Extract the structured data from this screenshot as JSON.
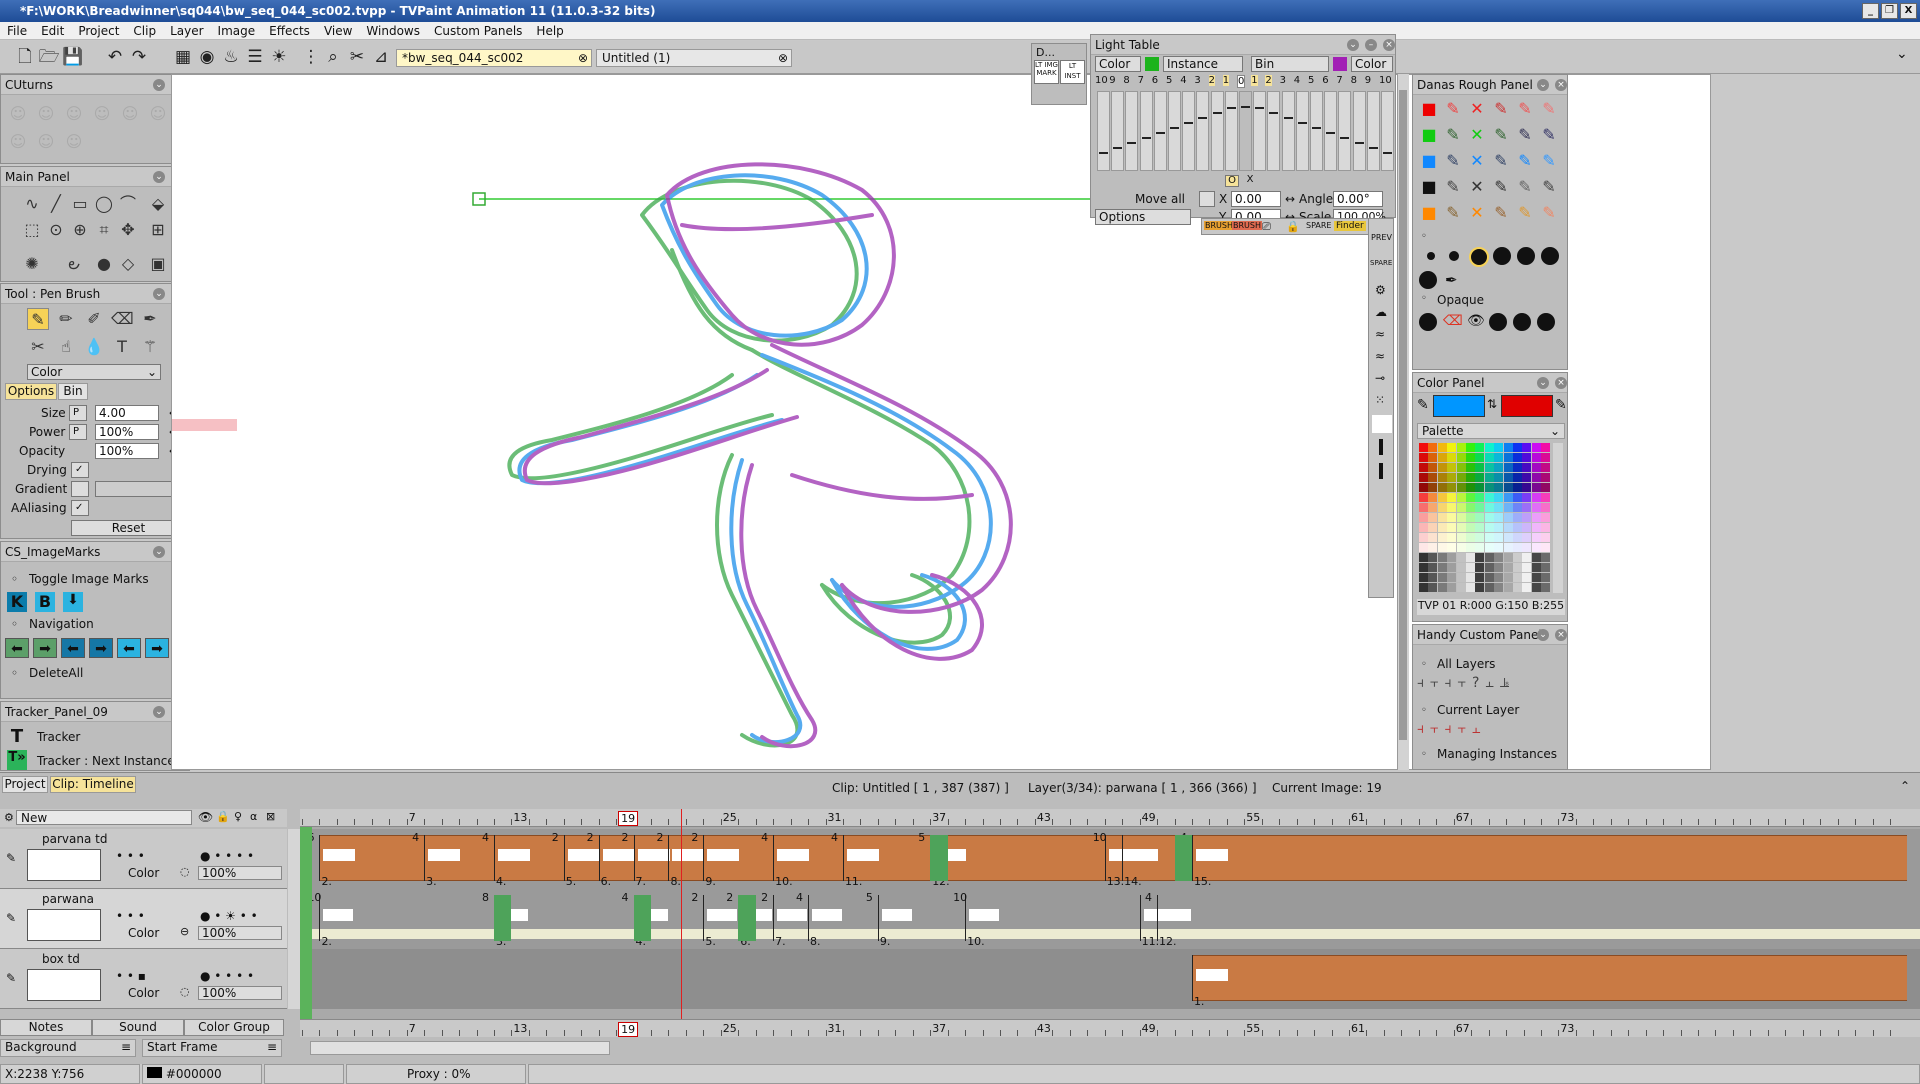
{
  "window": {
    "title": "*F:\\WORK\\Breadwinner\\sq044\\bw_seq_044_sc002.tvpp - TVPaint Animation 11 (11.0.3-32 bits)",
    "min": "_",
    "max": "❐",
    "close": "X"
  },
  "menu": [
    "File",
    "Edit",
    "Project",
    "Clip",
    "Layer",
    "Image",
    "Effects",
    "View",
    "Windows",
    "Custom Panels",
    "Help"
  ],
  "doc_tabs": {
    "active": "*bw_seq_044_sc002",
    "inactive": "Untitled (1)"
  },
  "cuturns": {
    "title": "CUturns"
  },
  "main_panel": {
    "title": "Main Panel"
  },
  "tool_panel": {
    "title": "Tool : Pen Brush",
    "mode": "Color",
    "tab_options": "Options",
    "tab_bin": "Bin",
    "size_label": "Size",
    "size": "4.00",
    "power_label": "Power",
    "power": "100%",
    "opacity_label": "Opacity",
    "opacity": "100%",
    "drying_label": "Drying",
    "gradient_label": "Gradient",
    "aaliasing_label": "AAliasing",
    "reset": "Reset",
    "p": "P"
  },
  "imagemarks": {
    "title": "CS_ImageMarks",
    "toggle": "Toggle Image Marks",
    "k": "K",
    "b": "B",
    "navigation": "Navigation",
    "deleteall": "DeleteAll"
  },
  "tracker": {
    "title": "Tracker_Panel_09",
    "tracker": "Tracker",
    "next": "Tracker : Next Instance"
  },
  "d_panel": {
    "title": "D...",
    "lt_mark": "LT IMG MARK",
    "lt_inst": "LT INST"
  },
  "light_table": {
    "title": "Light Table",
    "color1": "Color",
    "instance": "Instance",
    "bin": "Bin",
    "color2": "Color",
    "left_nums": [
      "10",
      "9",
      "8",
      "7",
      "6",
      "5",
      "4",
      "3",
      "2",
      "1"
    ],
    "center": "0",
    "right_nums": [
      "1",
      "2",
      "3",
      "4",
      "5",
      "6",
      "7",
      "8",
      "9",
      "10"
    ],
    "o": "O",
    "x": "X",
    "move_all": "Move all",
    "x_label": "X",
    "x_val": "0.00",
    "y_label": "Y",
    "y_val": "0.00",
    "angle_label": "Angle",
    "angle": "0.00°",
    "scale_label": "Scale",
    "scale": "100.00%",
    "options": "Options"
  },
  "brush_strip": {
    "brush1": "BRUSH",
    "brush2": "BRUSH",
    "spare": "SPARE",
    "finder": "Finder"
  },
  "side_strip": {
    "prev": "PREV",
    "spare": "SPARE"
  },
  "danas": {
    "title": "Danas Rough Panel",
    "opaque": "Opaque"
  },
  "color_panel": {
    "title": "Color Panel",
    "palette": "Palette",
    "info": "TVP 01 R:000 G:150 B:255",
    "colorA": "#0096ff",
    "colorB": "#e00000"
  },
  "handy": {
    "title": "Handy Custom Panel",
    "all_layers": "All Layers",
    "current_layer": "Current Layer",
    "managing": "Managing Instances"
  },
  "timeline": {
    "tab_project": "Project",
    "tab_clip": "Clip: Timeline",
    "clip_info": "Clip: Untitled [ 1 , 387  (387) ]",
    "layer_info": "Layer(3/34): parwana [ 1 , 366  (366) ]",
    "current_image": "Current Image: 19",
    "new_label": "New",
    "current_frame": "19",
    "ruler": [
      "7",
      "13",
      "19",
      "25",
      "31",
      "37",
      "43",
      "49",
      "55",
      "61",
      "67",
      "73"
    ],
    "layers": [
      {
        "name": "parvana td",
        "color": "Color",
        "opacity": "100%",
        "exposures": [
          {
            "f": "2.",
            "h": "6"
          },
          {
            "f": "3.",
            "h": "4"
          },
          {
            "f": "4.",
            "h": "4"
          },
          {
            "f": "5.",
            "h": "2"
          },
          {
            "f": "6.",
            "h": "2"
          },
          {
            "f": "7.",
            "h": "2"
          },
          {
            "f": "8.",
            "h": "2"
          },
          {
            "f": "9.",
            "h": "2"
          },
          {
            "f": "10.",
            "h": "4"
          },
          {
            "f": "11.",
            "h": "4"
          },
          {
            "f": "12.",
            "h": "5"
          },
          {
            "f": "13.",
            "h": "10"
          },
          {
            "f": "14.",
            "h": ""
          },
          {
            "f": "15.",
            "h": "4"
          }
        ]
      },
      {
        "name": "parwana",
        "color": "Color",
        "opacity": "100%",
        "exposures": [
          {
            "f": "2.",
            "h": "10"
          },
          {
            "f": "3.",
            "h": "8"
          },
          {
            "f": "4.",
            "h": "4"
          },
          {
            "f": "5.",
            "h": "2"
          },
          {
            "f": "6.",
            "h": "2"
          },
          {
            "f": "7.",
            "h": "2"
          },
          {
            "f": "8.",
            "h": "4"
          },
          {
            "f": "9.",
            "h": "5"
          },
          {
            "f": "10.",
            "h": "10"
          },
          {
            "f": "11.",
            "h": ""
          },
          {
            "f": "12.",
            "h": "4"
          }
        ]
      },
      {
        "name": "box td",
        "color": "Color",
        "opacity": "100%",
        "exposures": [
          {
            "f": "1.",
            "h": ""
          }
        ]
      }
    ],
    "notes": "Notes",
    "sound": "Sound",
    "color_group": "Color Group",
    "background": "Background",
    "start_frame": "Start Frame"
  },
  "status": {
    "coords": "X:2238  Y:756",
    "color": "#000000",
    "proxy": "Proxy : 0%"
  }
}
